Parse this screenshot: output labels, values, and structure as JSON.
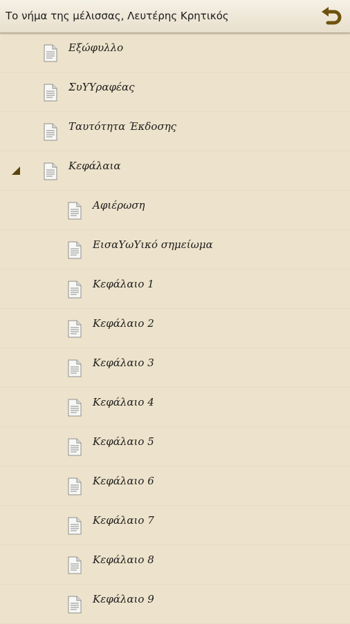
{
  "header": {
    "title": "Το νήμα της μέλισσας, Λευτέρης Κρητικός",
    "back_icon": "undo-arrow-icon",
    "accent": "#7a5a10"
  },
  "toc": {
    "items": [
      {
        "label": "Εξώφυλλο",
        "level": 0
      },
      {
        "label": "ΣυΥΥραφέας",
        "level": 0
      },
      {
        "label": "Ταυτότητα Έκδοσης",
        "level": 0
      },
      {
        "label": "Κεφάλαια",
        "level": 0,
        "expanded": true
      },
      {
        "label": "Αφιέρωση",
        "level": 1
      },
      {
        "label": "ΕισαΥωΥικό σημείωμα",
        "level": 1
      },
      {
        "label": "Κεφάλαιο 1",
        "level": 1
      },
      {
        "label": "Κεφάλαιο 2",
        "level": 1
      },
      {
        "label": "Κεφάλαιο 3",
        "level": 1
      },
      {
        "label": "Κεφάλαιο 4",
        "level": 1
      },
      {
        "label": "Κεφάλαιο 5",
        "level": 1
      },
      {
        "label": "Κεφάλαιο 6",
        "level": 1
      },
      {
        "label": "Κεφάλαιο 7",
        "level": 1
      },
      {
        "label": "Κεφάλαιο 8",
        "level": 1
      },
      {
        "label": "Κεφάλαιο 9",
        "level": 1
      }
    ]
  }
}
